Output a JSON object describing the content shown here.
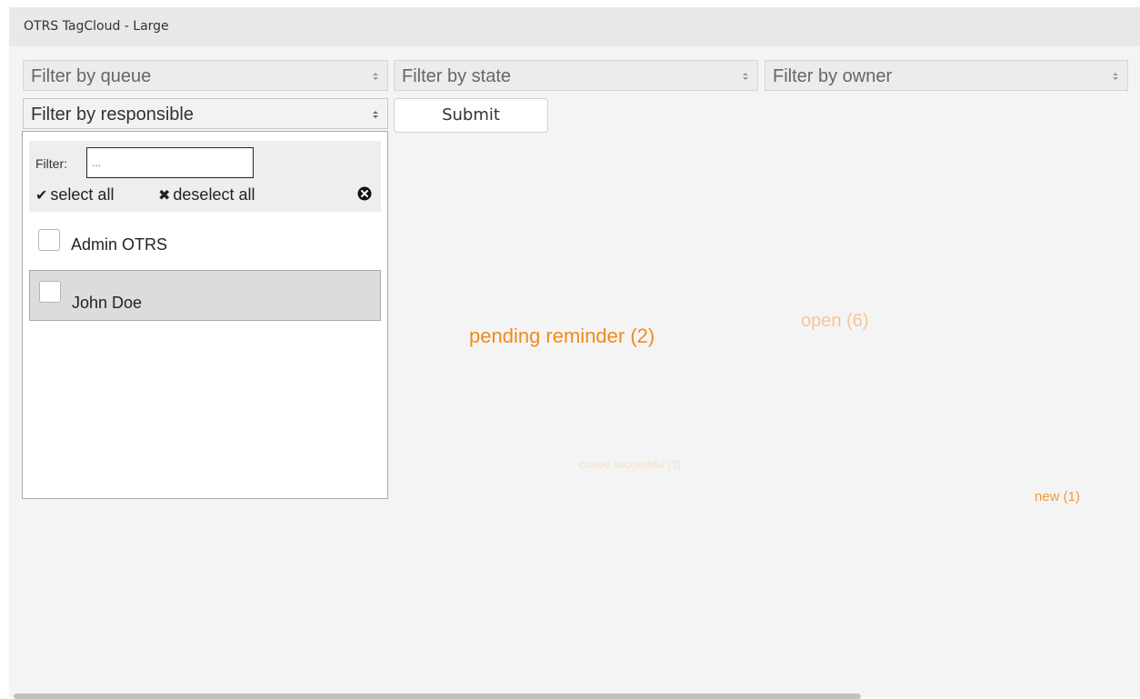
{
  "widget": {
    "title": "OTRS TagCloud - Large"
  },
  "filters": {
    "queue_placeholder": "Filter by queue",
    "state_placeholder": "Filter by state",
    "owner_placeholder": "Filter by owner",
    "responsible_placeholder": "Filter by responsible",
    "submit_label": "Submit"
  },
  "dropdown": {
    "filter_label": "Filter:",
    "filter_placeholder": "...",
    "select_all": "select all",
    "deselect_all": "deselect all",
    "items": [
      {
        "label": "Admin OTRS"
      },
      {
        "label": "John Doe"
      }
    ]
  },
  "tag_cloud": [
    {
      "label": "pending reminder (2)",
      "color": "#ef8c1c"
    },
    {
      "label": "open (6)",
      "color": "#f2c798"
    },
    {
      "label": "closed successful (3)",
      "color": "#f7e0c6"
    },
    {
      "label": "new (1)",
      "color": "#ef9a3a"
    }
  ]
}
